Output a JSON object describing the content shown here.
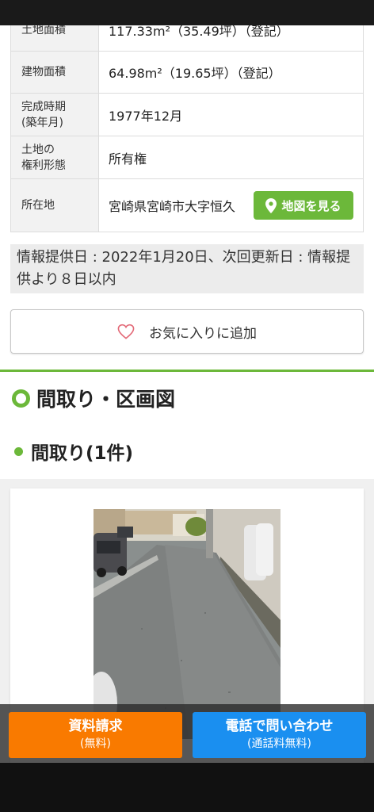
{
  "spec": {
    "rows": [
      {
        "label": "土地面積",
        "value": "117.33m²（35.49坪）（登記）"
      },
      {
        "label": "建物面積",
        "value": "64.98m²（19.65坪）（登記）"
      },
      {
        "label_line1": "完成時期",
        "label_line2": "(築年月)",
        "value": "1977年12月"
      },
      {
        "label_line1": "土地の",
        "label_line2": "権利形態",
        "value": "所有権"
      },
      {
        "label": "所在地",
        "value": "宮崎県宮崎市大字恒久"
      }
    ],
    "map_button_label": "地図を見る",
    "map_button_icon": "map-pin-icon"
  },
  "info_text": "情報提供日 : 2022年1月20日、次回更新日 : 情報提供より８日以内",
  "favorite": {
    "label": "お気に入りに追加",
    "icon": "heart-icon"
  },
  "section": {
    "title": "間取り・区画図",
    "subtitle": "間取り(1件)"
  },
  "cta": {
    "request": {
      "main": "資料請求",
      "sub": "(無料)"
    },
    "phone": {
      "main": "電話で問い合わせ",
      "sub": "(通話料無料)"
    }
  },
  "colors": {
    "accent_green": "#6cb83a",
    "cta_orange": "#f97a00",
    "cta_blue": "#1a8ff0"
  }
}
